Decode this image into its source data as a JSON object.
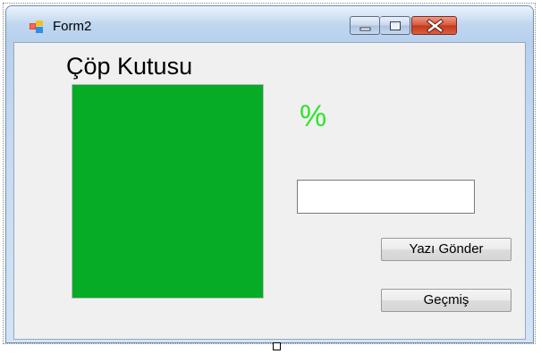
{
  "window": {
    "title": "Form2",
    "icon": "windows-form-icon",
    "controls": {
      "minimize_icon": "minimize-icon",
      "maximize_icon": "maximize-icon",
      "close_icon": "close-icon"
    }
  },
  "form": {
    "heading": "Çöp Kutusu",
    "fill_level_percent": 100,
    "fill_color": "#06ab26",
    "percent_label": "%",
    "percent_label_color": "#2fe52f",
    "text_input": {
      "value": "",
      "placeholder": ""
    },
    "send_button_label": "Yazı Gönder",
    "history_button_label": "Geçmiş"
  }
}
